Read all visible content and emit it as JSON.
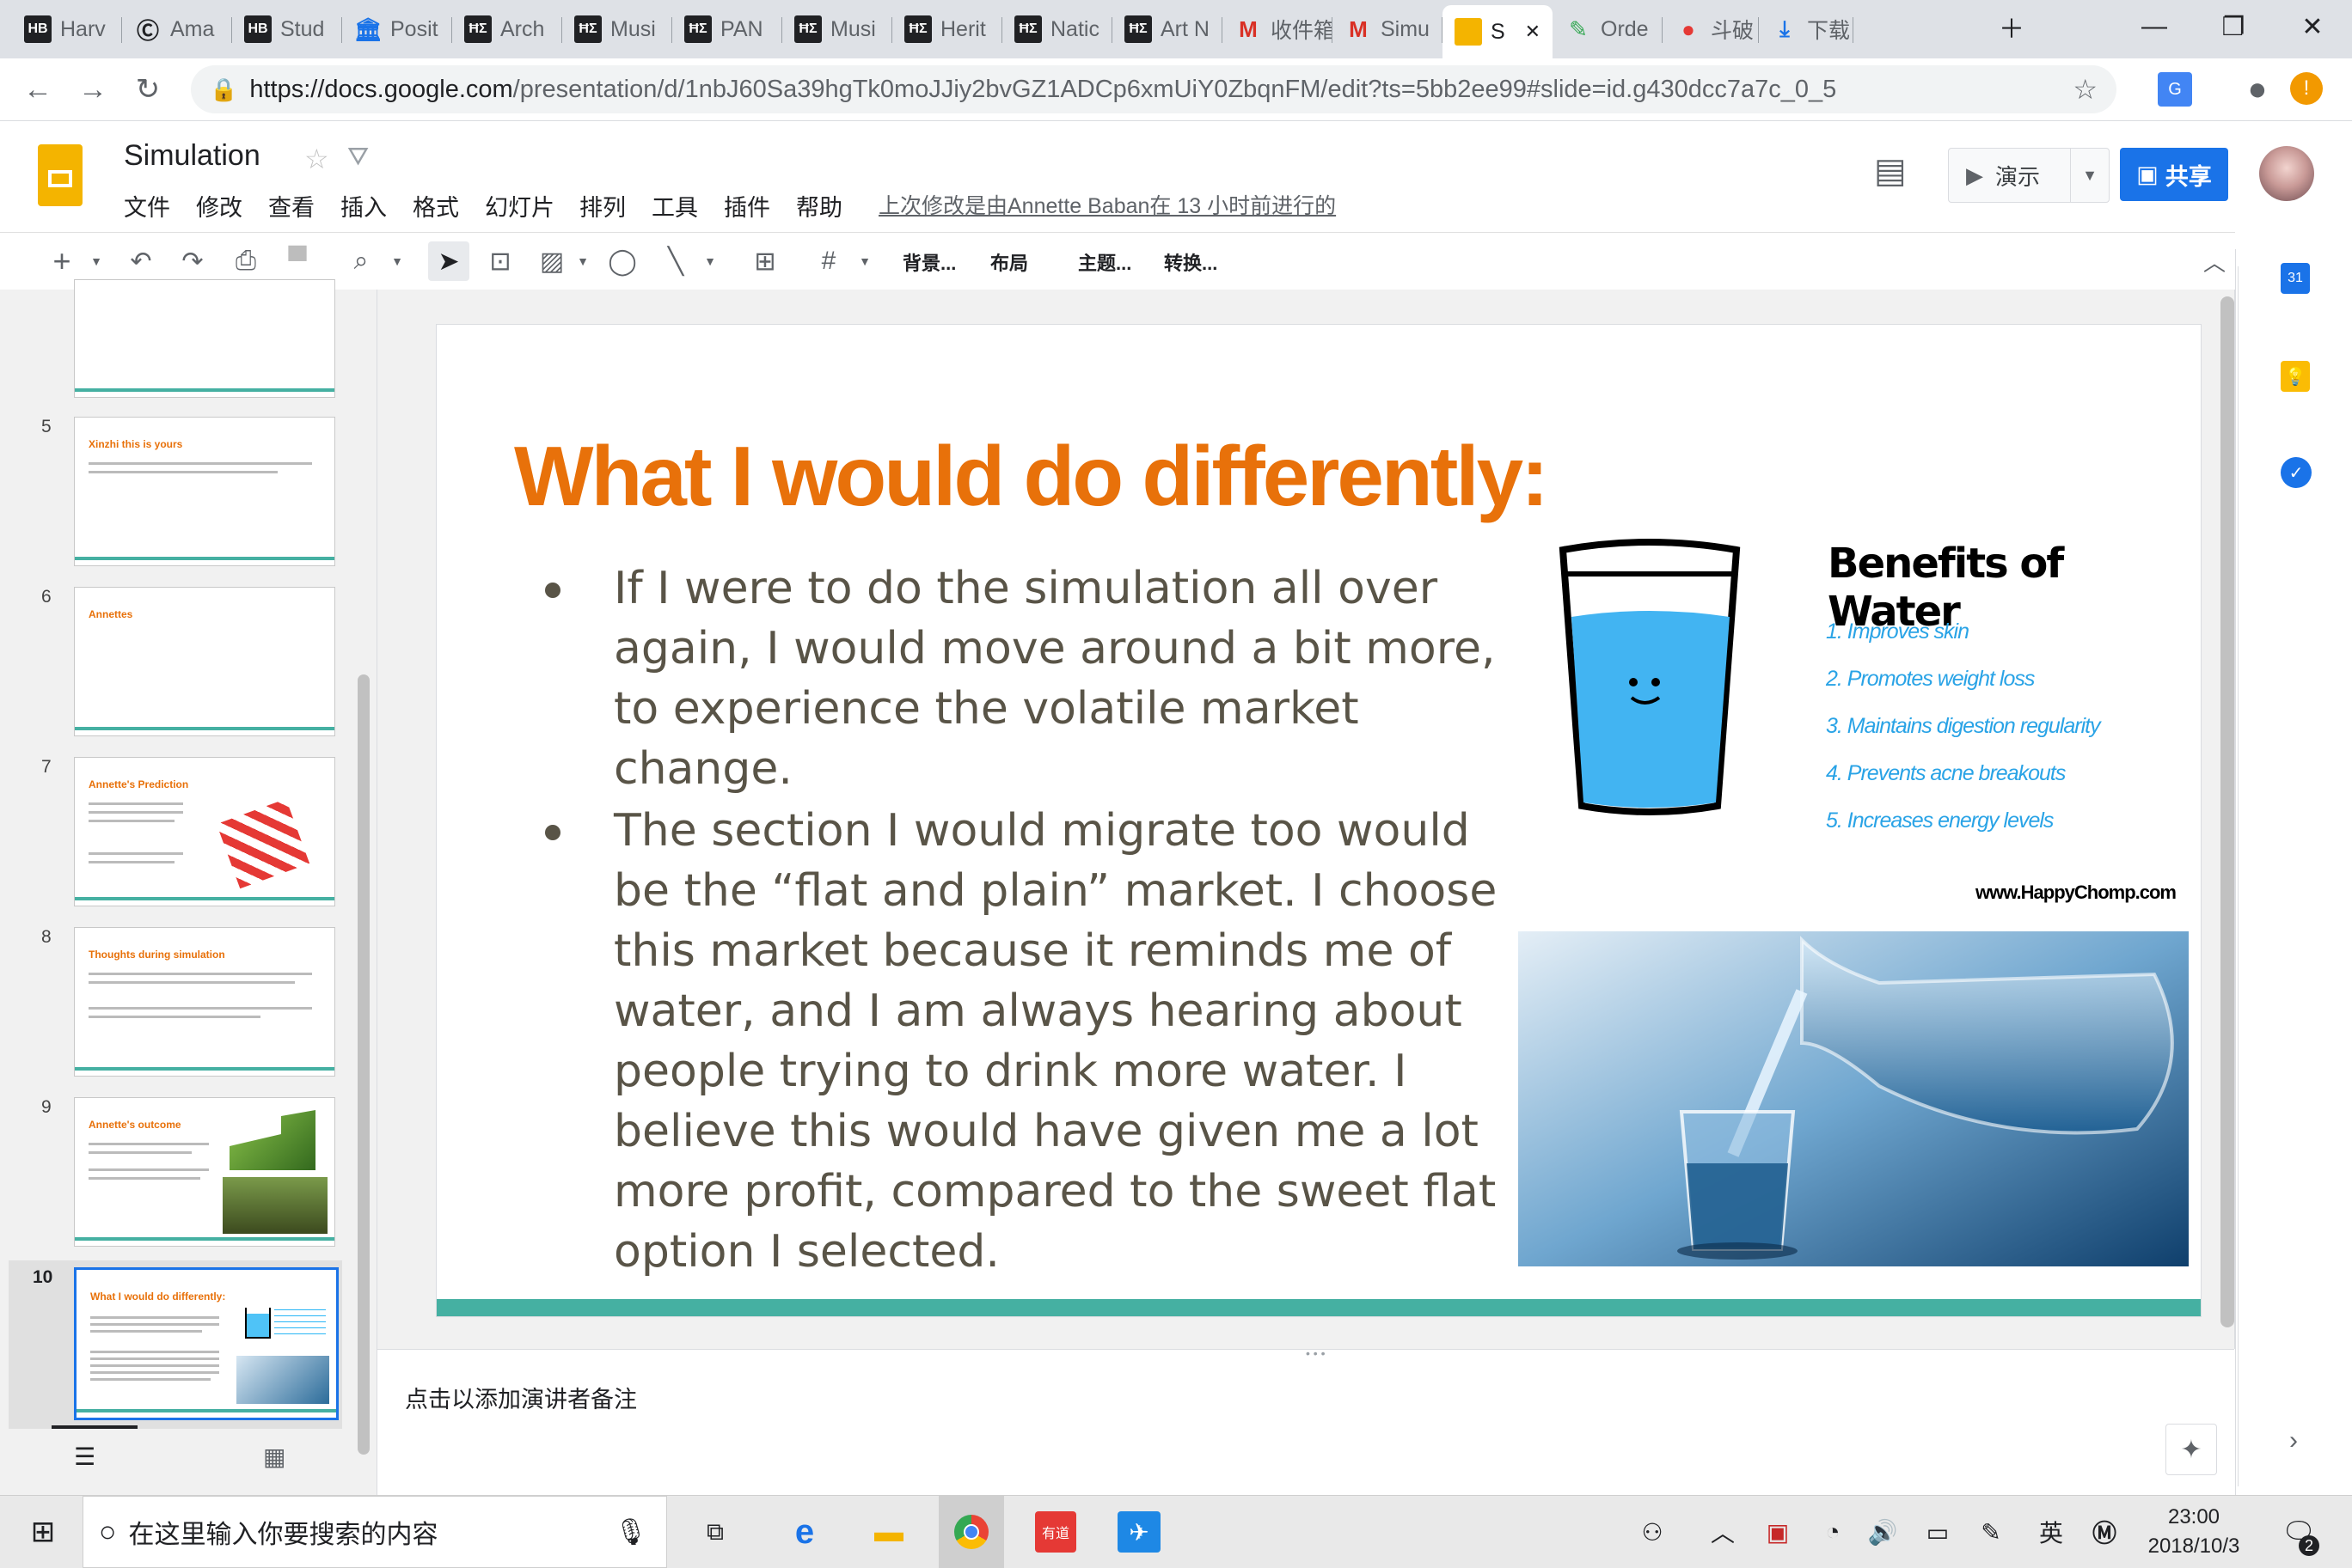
{
  "browser": {
    "tabs": [
      {
        "label": "Harv",
        "icon": "HB"
      },
      {
        "label": "Ama",
        "icon": "C"
      },
      {
        "label": "Stud",
        "icon": "HB"
      },
      {
        "label": "Posit",
        "icon": "bank"
      },
      {
        "label": "Arch",
        "icon": "HBR"
      },
      {
        "label": "Musi",
        "icon": "HBR"
      },
      {
        "label": "PAN",
        "icon": "HBR"
      },
      {
        "label": "Musi",
        "icon": "HBR"
      },
      {
        "label": "Herit",
        "icon": "HBR"
      },
      {
        "label": "Natic",
        "icon": "HBR"
      },
      {
        "label": "Art N",
        "icon": "HBR"
      },
      {
        "label": "收件箱",
        "icon": "M"
      },
      {
        "label": "Simu",
        "icon": "M"
      },
      {
        "label": "S",
        "icon": "slides",
        "active": true
      },
      {
        "label": "Orde",
        "icon": "pencil"
      },
      {
        "label": "斗破",
        "icon": "youku"
      },
      {
        "label": "下载",
        "icon": "download"
      }
    ],
    "url_host": "https://docs.google.com",
    "url_path": "/presentation/d/1nbJ60Sa39hgTk0moJJiy2bvGZ1ADCp6xmUiY0ZbqnFM/edit?ts=5bb2ee99#slide=id.g430dcc7a7c_0_5"
  },
  "docs": {
    "title": "Simulation",
    "menu": [
      "文件",
      "修改",
      "查看",
      "插入",
      "格式",
      "幻灯片",
      "排列",
      "工具",
      "插件",
      "帮助"
    ],
    "last_edit": "上次修改是由Annette Baban在 13 小时前进行的",
    "present_label": "演示",
    "share_label": "共享",
    "toolbar_text": [
      "背景...",
      "布局",
      "主题...",
      "转换..."
    ]
  },
  "filmstrip": {
    "slides": [
      {
        "num": "",
        "title": ""
      },
      {
        "num": "5",
        "title": "Xinzhi this is yours"
      },
      {
        "num": "6",
        "title": "Annettes"
      },
      {
        "num": "7",
        "title": "Annette's Prediction"
      },
      {
        "num": "8",
        "title": "Thoughts during simulation"
      },
      {
        "num": "9",
        "title": "Annette's outcome"
      },
      {
        "num": "10",
        "title": "What I would do differently:"
      }
    ]
  },
  "slide": {
    "title": "What I would do differently:",
    "bullets": [
      "If I were to do the simulation all over again, I would move around a bit more, to experience the volatile market change.",
      "The section I would migrate too would be the “flat and plain” market. I choose this market because it reminds me of water, and I am always hearing about people trying to drink more water. I believe this would have given me a lot more profit, compared to the sweet flat option I selected."
    ],
    "image_text": {
      "heading": "Benefits of Water",
      "items": [
        "1. Improves skin",
        "2. Promotes weight loss",
        "3. Maintains digestion regularity",
        "4. Prevents acne breakouts",
        "5. Increases energy levels"
      ],
      "site": "www.HappyChomp.com"
    }
  },
  "notes": {
    "placeholder": "点击以添加演讲者备注"
  },
  "taskbar": {
    "search_placeholder": "在这里输入你要搜索的内容",
    "ime": "英",
    "time": "23:00",
    "date": "2018/10/3",
    "notification_count": "2"
  },
  "colors": {
    "accent": "#e8710a",
    "teal": "#45b0a2",
    "share": "#1a73e8",
    "bullet_text": "#595447"
  }
}
